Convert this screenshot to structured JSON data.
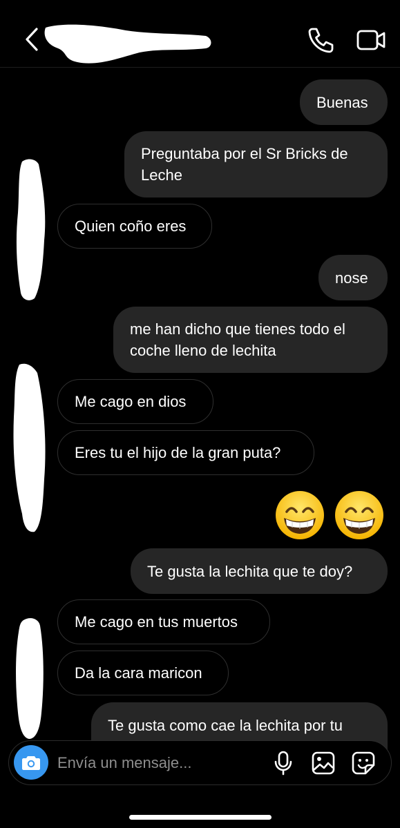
{
  "thread": {
    "messages": [
      {
        "direction": "outgoing",
        "text": "Buenas"
      },
      {
        "direction": "outgoing",
        "text": "Preguntaba por el Sr Bricks de\nLeche"
      },
      {
        "direction": "incoming",
        "text": "Quien coño eres"
      },
      {
        "direction": "outgoing",
        "text": "nose"
      },
      {
        "direction": "outgoing",
        "text": "me han dicho que tienes todo el\ncoche lleno de lechita"
      },
      {
        "direction": "incoming",
        "text": "Me cago en dios"
      },
      {
        "direction": "incoming",
        "text": "Eres tu el hijo de la gran puta?"
      },
      {
        "direction": "outgoing",
        "text": "😁😁",
        "kind": "emoji"
      },
      {
        "direction": "outgoing",
        "text": "Te gusta la lechita que te doy?"
      },
      {
        "direction": "incoming",
        "text": "Me cago en tus muertos"
      },
      {
        "direction": "incoming",
        "text": "Da la cara maricon"
      },
      {
        "direction": "outgoing",
        "text": "Te gusta como cae la lechita por tu"
      }
    ]
  },
  "composer": {
    "placeholder": "Envía un mensaje..."
  },
  "icons": {
    "back": "chevron-left-icon",
    "call": "phone-icon",
    "video": "video-camera-icon",
    "camera": "camera-icon",
    "mic": "microphone-icon",
    "gallery": "image-icon",
    "sticker": "sticker-icon"
  },
  "colors": {
    "background": "#000000",
    "outgoing_bubble": "#262626",
    "incoming_border": "#2f2f2f",
    "camera_button": "#3797f0",
    "placeholder": "#8e8e8e"
  }
}
